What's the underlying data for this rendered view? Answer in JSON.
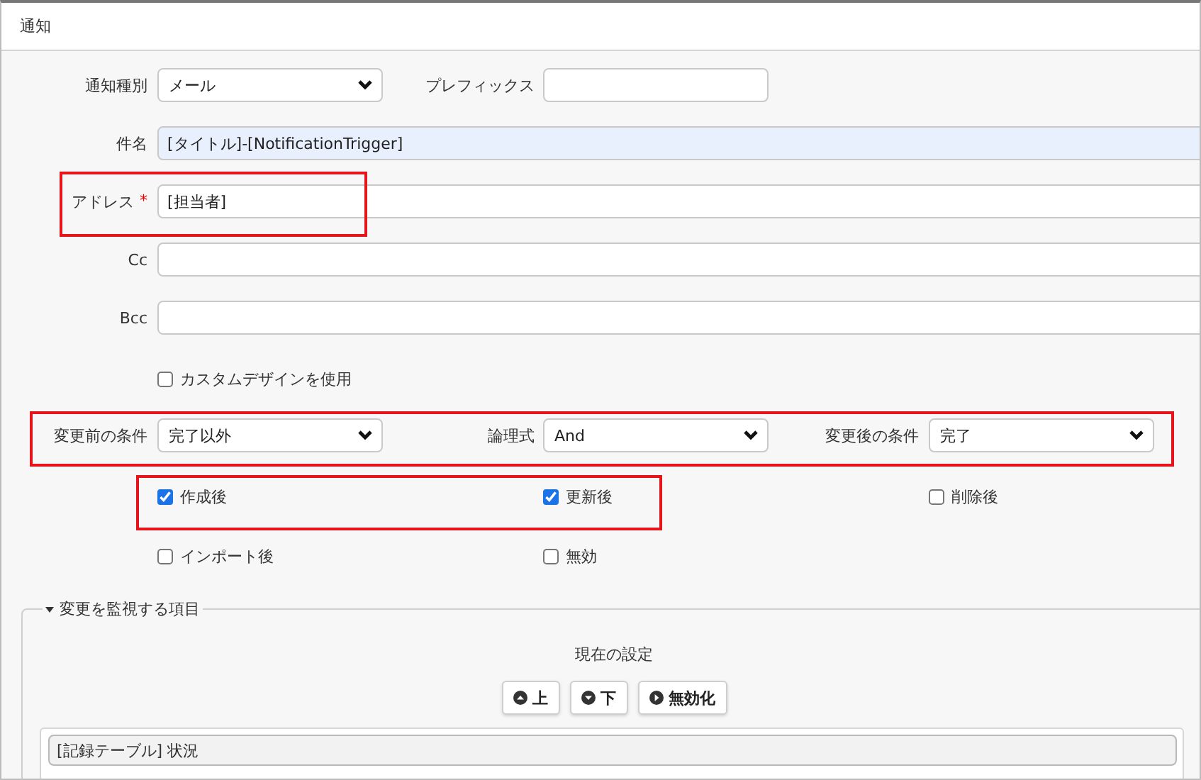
{
  "window": {
    "title": "通知"
  },
  "notification_type": {
    "label": "通知種別",
    "value": "メール"
  },
  "prefix": {
    "label": "プレフィックス"
  },
  "subject": {
    "label": "件名",
    "value": "[タイトル]-[NotificationTrigger]",
    "autofilled": true
  },
  "address": {
    "label": "アドレス",
    "required_mark": "*",
    "value": "[担当者]",
    "highlighted": true
  },
  "cc": {
    "label": "Cc"
  },
  "bcc": {
    "label": "Bcc"
  },
  "custom_design": {
    "label": "カスタムデザインを使用",
    "checked": false
  },
  "conditions": {
    "highlighted": true,
    "before": {
      "label": "変更前の条件",
      "value": "完了以外"
    },
    "logic": {
      "label": "論理式",
      "value": "And"
    },
    "after": {
      "label": "変更後の条件",
      "value": "完了"
    }
  },
  "trigger_rows": [
    {
      "items": [
        {
          "label": "作成後",
          "checked": true,
          "highlighted": true
        },
        {
          "label": "更新後",
          "checked": true,
          "highlighted": true
        },
        {
          "label": "削除後",
          "checked": false,
          "highlighted": false
        }
      ]
    },
    {
      "items": [
        {
          "label": "インポート後",
          "checked": false,
          "highlighted": false
        },
        {
          "label": "無効",
          "checked": false,
          "highlighted": false
        }
      ]
    }
  ],
  "watched_items": {
    "legend": "変更を監視する項目",
    "expanded": true,
    "heading": "現在の設定",
    "buttons": [
      {
        "label": "上",
        "kind": "up"
      },
      {
        "label": "下",
        "kind": "down"
      },
      {
        "label": "無効化",
        "kind": "disable"
      }
    ],
    "items": [
      {
        "label": "[記録テーブル] 状況"
      }
    ]
  }
}
